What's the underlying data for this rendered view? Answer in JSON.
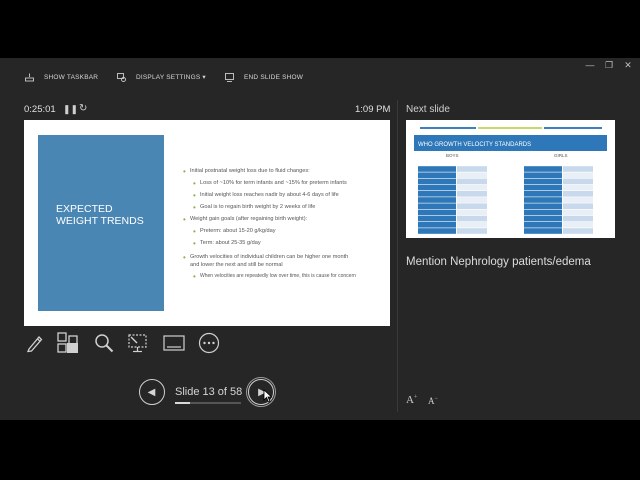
{
  "window_controls": {
    "minimize": "—",
    "restore": "❐",
    "close": "✕"
  },
  "toolbar": {
    "show_taskbar": "SHOW TASKBAR",
    "display_settings": "DISPLAY SETTINGS ▾",
    "end_slide_show": "END SLIDE SHOW"
  },
  "timer": {
    "elapsed": "0:25:01",
    "pause_glyph": "❚❚",
    "reset_glyph": "↻"
  },
  "clock": "1:09 PM",
  "current_slide": {
    "title": "EXPECTED WEIGHT TRENDS",
    "bullets": [
      {
        "text": "Initial postnatal weight loss due to fluid changes:",
        "level": 1
      },
      {
        "text": "Loss of ~10% for term infants and ~15% for preterm infants",
        "level": 2
      },
      {
        "text": "Initial weight loss reaches nadir by about 4-6 days of life",
        "level": 2
      },
      {
        "text": "Goal is to regain birth weight by 2 weeks of life",
        "level": 2
      },
      {
        "text": "Weight gain goals (after regaining birth weight):",
        "level": 1
      },
      {
        "text": "Preterm:  about 15-20 g/kg/day",
        "level": 2
      },
      {
        "text": "Term:  about 25-35 g/day",
        "level": 2
      },
      {
        "text": "Growth velocities of individual children can be higher one month",
        "level": 1
      },
      {
        "text": "and lower the next and still be normal",
        "level": 0
      },
      {
        "text": "When velocities are repeatedly low over time, this is cause for concern",
        "level": 2
      }
    ]
  },
  "tools": [
    "pen-icon",
    "slide-grid-icon",
    "zoom-icon",
    "pointer-screen-icon",
    "subtitles-icon",
    "more-options-icon"
  ],
  "navigation": {
    "prev_glyph": "◀",
    "next_glyph": "▶",
    "slide_counter": "Slide 13 of 58",
    "progress": 0.224
  },
  "next_slide": {
    "label": "Next slide",
    "title": "WHO GROWTH VELOCITY STANDARDS",
    "boys_label": "BOYS",
    "girls_label": "GIRLS"
  },
  "notes": "Mention Nephrology patients/edema",
  "font_controls": {
    "increase": "A",
    "decrease": "A"
  },
  "colors": {
    "slide_blue": "#4a86b4",
    "bullet_green": "#88b24a",
    "table_blue": "#2e77b8",
    "background": "#262626"
  }
}
